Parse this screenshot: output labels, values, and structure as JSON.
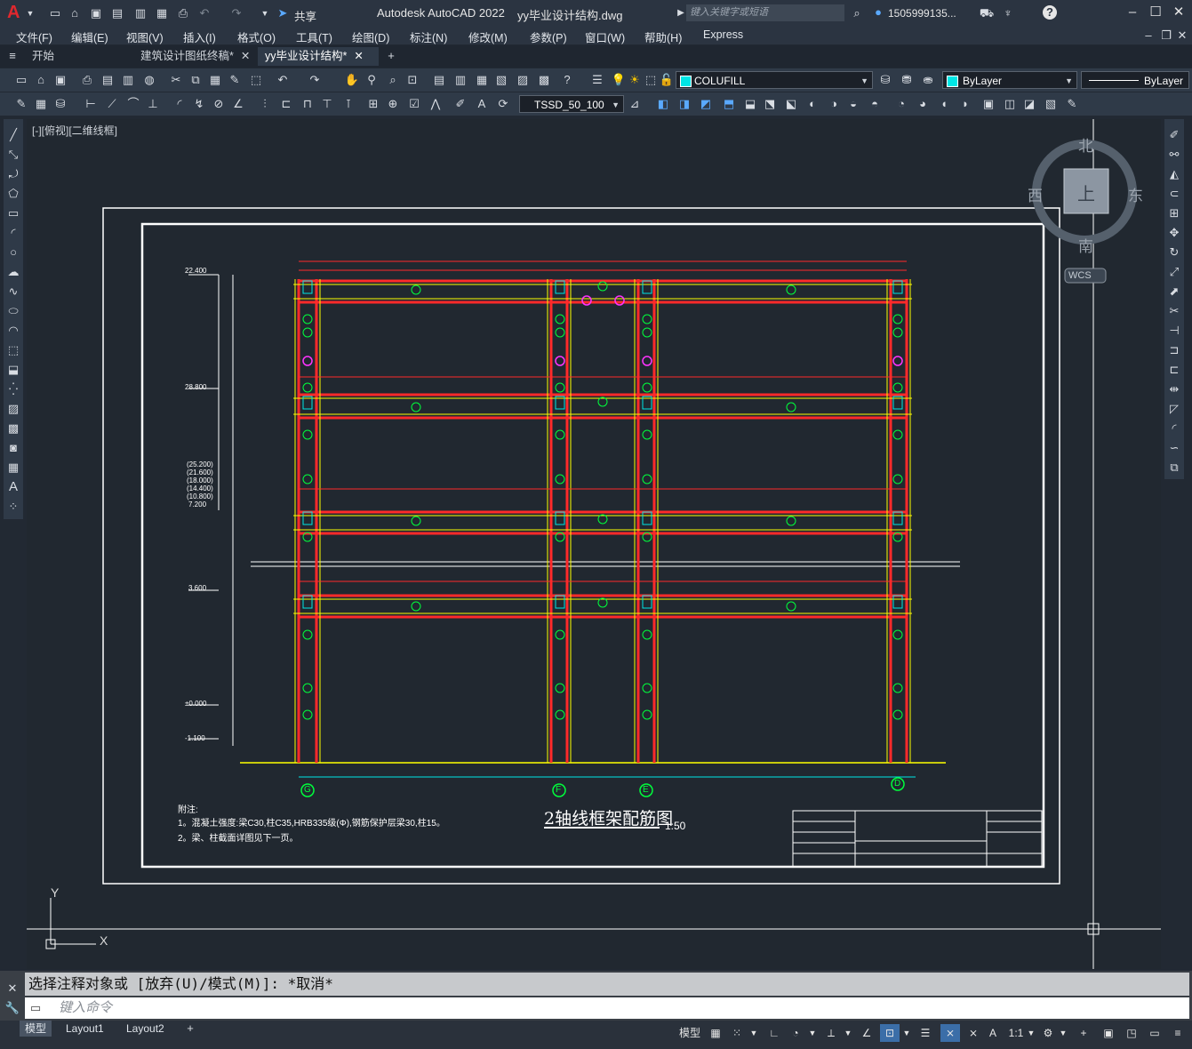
{
  "titlebar": {
    "app_title": "Autodesk AutoCAD 2022",
    "file_title": "yy毕业设计结构.dwg",
    "share_label": "共享",
    "search_placeholder": "键入关键字或短语",
    "user_name": "1505999135...",
    "logo_letter": "A"
  },
  "menubar": {
    "items": [
      "文件(F)",
      "编辑(E)",
      "视图(V)",
      "插入(I)",
      "格式(O)",
      "工具(T)",
      "绘图(D)",
      "标注(N)",
      "修改(M)",
      "参数(P)",
      "窗口(W)",
      "帮助(H)",
      "Express"
    ]
  },
  "doc_tabs": {
    "items": [
      "开始",
      "建筑设计图纸终稿*",
      "yy毕业设计结构*"
    ],
    "active_index": 2
  },
  "toolbar": {
    "layer_value": "COLUFILL",
    "color_value": "ByLayer",
    "linetype_value": "ByLayer",
    "dimstyle_value": "TSSD_50_100",
    "layer_color": "#00e6e6",
    "color_swatch": "#00e6e6"
  },
  "viewport": {
    "view_label": "[-][俯视][二维线框]",
    "viewcube": {
      "north": "北",
      "south": "南",
      "east": "东",
      "west": "西",
      "top": "上",
      "wcs": "WCS"
    },
    "ucs": {
      "x": "X",
      "y": "Y"
    }
  },
  "drawing": {
    "title": "2轴线框架配筋图",
    "scale": "1:50",
    "notes_heading": "附注:",
    "notes": [
      "1。混凝土强度:梁C30,柱C35,HRB335级(Φ),钢筋保护层梁30,柱15。",
      "2。梁、柱截面详图见下一页。"
    ],
    "axis_labels": [
      "G",
      "F",
      "E",
      "D"
    ],
    "elevations": [
      "22.400",
      "28.800",
      "(25.200)",
      "(21.600)",
      "(18.000)",
      "(14.400)",
      "(10.800)",
      "7.200",
      "3.600",
      "±0.000",
      "-1.100"
    ]
  },
  "command": {
    "history": "选择注释对象或 [放弃(U)/模式(M)]: *取消*",
    "placeholder": "键入命令"
  },
  "layouts": {
    "items": [
      "模型",
      "Layout1",
      "Layout2"
    ],
    "active_index": 0
  },
  "statusbar": {
    "model_label": "模型",
    "scale_label": "1:1"
  }
}
